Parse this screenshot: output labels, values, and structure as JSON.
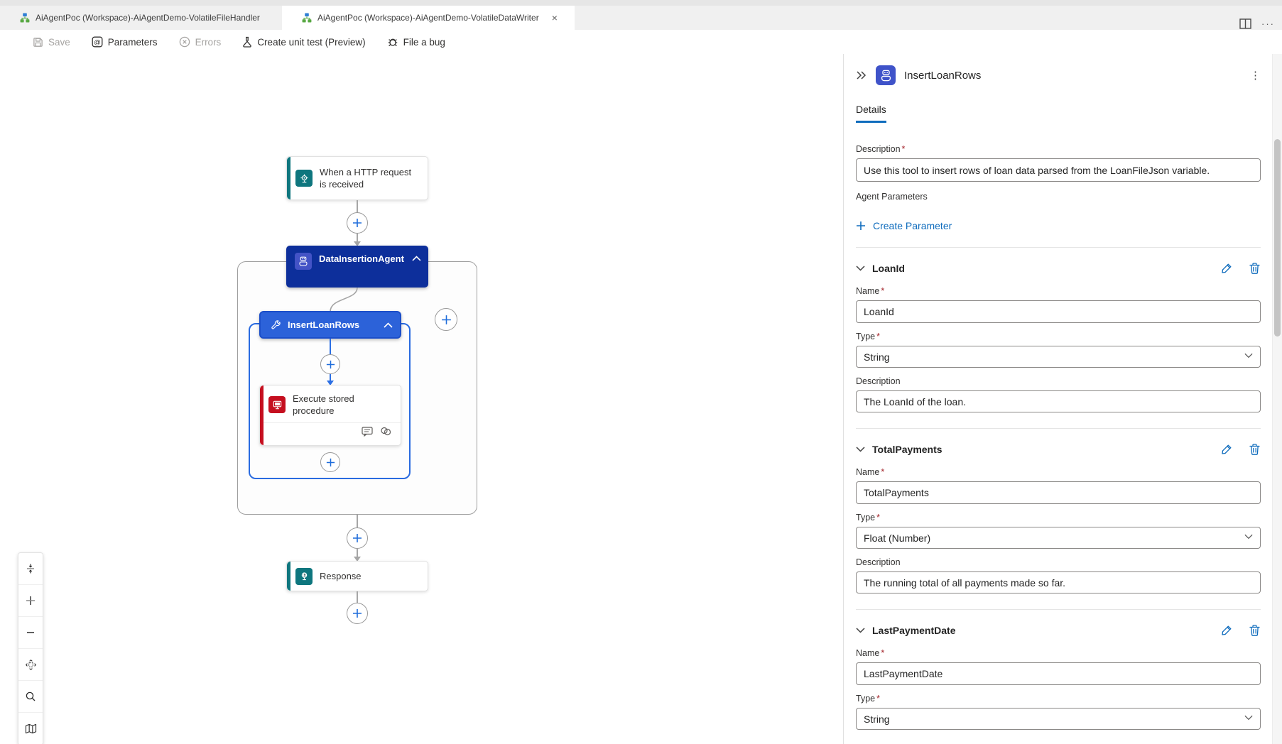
{
  "titlebar": {
    "tab1_label": "AiAgentPoc (Workspace)-AiAgentDemo-VolatileFileHandler",
    "tab2_label": "AiAgentPoc (Workspace)-AiAgentDemo-VolatileDataWriter",
    "close_glyph": "×",
    "more_glyph": "···"
  },
  "toolbar": {
    "save_label": "Save",
    "parameters_label": "Parameters",
    "errors_label": "Errors",
    "unit_test_label": "Create unit test (Preview)",
    "file_bug_label": "File a bug"
  },
  "canvas": {
    "trigger_title": "When a HTTP request is received",
    "agent_title": "DataInsertionAgent",
    "tool_title": "InsertLoanRows",
    "action_title": "Execute stored procedure",
    "response_title": "Response"
  },
  "colors": {
    "accent_blue": "#0f6cbd",
    "agent_navy": "#0d2f9b",
    "tool_blue": "#2c62d9",
    "trigger_teal": "#0e767e",
    "sql_red": "#c50f1f"
  },
  "panel": {
    "title": "InsertLoanRows",
    "details_tab": "Details",
    "required_mark": "*",
    "more_glyph": "⋮",
    "description_label": "Description",
    "description_value": "Use this tool to insert rows of loan data parsed from the LoanFileJson variable.",
    "agent_parameters_label": "Agent Parameters",
    "create_parameter_label": "Create Parameter",
    "name_label": "Name",
    "type_label": "Type",
    "param_description_label": "Description",
    "parameters": [
      {
        "title": "LoanId",
        "name": "LoanId",
        "type": "String",
        "description": "The LoanId of the loan."
      },
      {
        "title": "TotalPayments",
        "name": "TotalPayments",
        "type": "Float (Number)",
        "description": "The running total of all payments made so far."
      },
      {
        "title": "LastPaymentDate",
        "name": "LastPaymentDate",
        "type": "String"
      }
    ]
  }
}
